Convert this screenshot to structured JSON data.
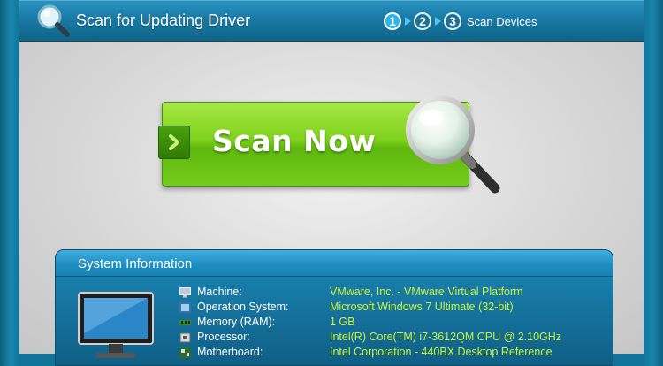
{
  "header": {
    "title": "Scan for Updating Driver",
    "steps": [
      "1",
      "2",
      "3"
    ],
    "active_step": "1",
    "current_step_label": "Scan Devices"
  },
  "scan_button": {
    "label": "Scan Now"
  },
  "system_info": {
    "title": "System Information",
    "rows": [
      {
        "label": "Machine:",
        "value": "VMware, Inc. - VMware Virtual Platform",
        "icon": "computer-icon"
      },
      {
        "label": "Operation System:",
        "value": "Microsoft Windows 7 Ultimate  (32-bit)",
        "icon": "windows-icon"
      },
      {
        "label": "Memory (RAM):",
        "value": "1 GB",
        "icon": "memory-icon"
      },
      {
        "label": "Processor:",
        "value": "Intel(R) Core(TM) i7-3612QM CPU @ 2.10GHz",
        "icon": "processor-icon"
      },
      {
        "label": "Motherboard:",
        "value": "Intel Corporation - 440BX Desktop Reference",
        "icon": "motherboard-icon"
      }
    ]
  },
  "colors": {
    "accent": "#1a86ad",
    "button_green": "#7fd21d",
    "value_text": "#c7f23b"
  }
}
